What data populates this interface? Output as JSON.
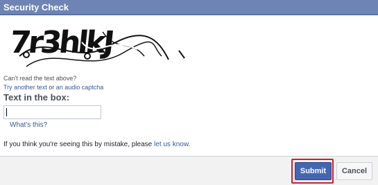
{
  "dialog": {
    "title": "Security Check"
  },
  "captcha": {
    "image_text": "7r3hlkJ",
    "cant_read": "Can't read the text above?",
    "try_another": "Try another text",
    "or": " or ",
    "audio_captcha": "an audio captcha"
  },
  "form": {
    "label": "Text in the box:",
    "input_value": "",
    "whats_this": "What's this?"
  },
  "notice": {
    "text": "If you think you're seeing this by mistake, please ",
    "link": "let us know",
    "end": "."
  },
  "buttons": {
    "submit": "Submit",
    "cancel": "Cancel"
  },
  "colors": {
    "title_bar": "#6d84b4",
    "link": "#365899",
    "submit": "#4267b2",
    "highlight": "#d91a2a"
  }
}
